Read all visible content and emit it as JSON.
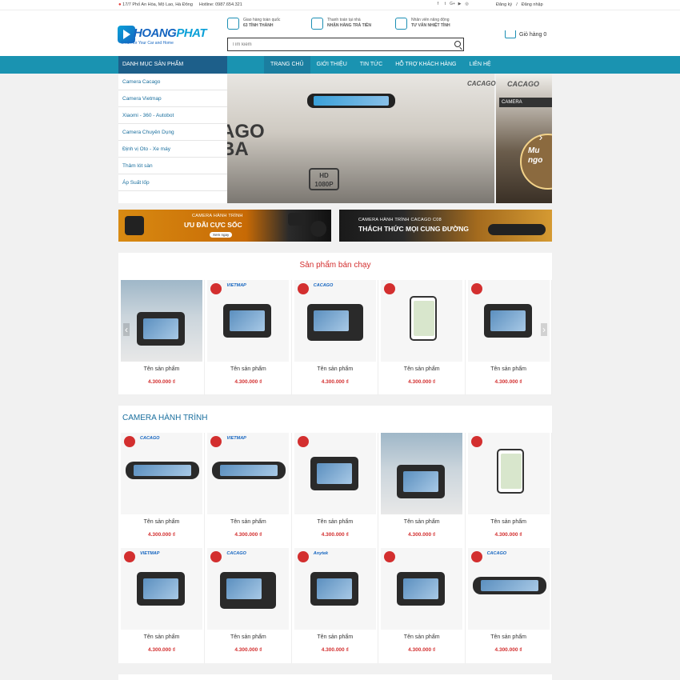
{
  "topbar": {
    "address": "17/7 Phố An Hòa, Mộ Lao, Hà Đông",
    "hotline_label": "Hotline",
    "hotline": "0987.654.321",
    "social": [
      "f",
      "t",
      "G+",
      "▶",
      "◎"
    ],
    "register": "Đăng ký",
    "separator": "/",
    "login": "Đăng nhập"
  },
  "header": {
    "logo_text_1": "HOANG",
    "logo_text_2": "PHAT",
    "logo_tagline": "Smart for Your Car and Home",
    "features": [
      {
        "line1": "Giao hàng toàn quốc",
        "line2": "63 TỈNH THÀNH"
      },
      {
        "line1": "Thanh toán tại nhà",
        "line2": "NHẬN HÀNG TRẢ TIỀN"
      },
      {
        "line1": "Nhân viên năng động",
        "line2": "TƯ VẤN NHIỆT TÌNH"
      }
    ],
    "search_placeholder": "Tìm kiếm",
    "cart_label": "Giỏ hàng 0"
  },
  "nav": {
    "category_title": "DANH MỤC SẢN PHẨM",
    "items": [
      "TRANG CHỦ",
      "GIỚI THIỆU",
      "TIN TỨC",
      "HỖ TRỢ KHÁCH HÀNG",
      "LIÊN HỆ"
    ],
    "active_index": 0
  },
  "sidebar": {
    "items": [
      "Camera Cacago",
      "Camera Vietmap",
      "Xiaomi - 360 - Autobot",
      "Camera Chuyên Dụng",
      "Định vị Oto - Xe máy",
      "Thảm lót sàn",
      "Áp Suất lốp"
    ]
  },
  "slider": {
    "slide1_brand": "CACAGO",
    "slide1_big": "AGO\nBA",
    "slide1_hd": "HD\n1080P",
    "slide2_brand": "CACAGO",
    "slide2_label": "CAMERA",
    "slide2_circle": "Mu\nngo"
  },
  "banners": [
    {
      "line1": "CAMERA HÀNH TRÌNH",
      "line2": "ƯU ĐÃI CỰC SỐC",
      "button": "Xem ngay"
    },
    {
      "line1": "CAMERA HÀNH TRÌNH CACAGO C08",
      "line2": "THÁCH THỨC MỌI CUNG ĐƯỜNG"
    }
  ],
  "best_sellers": {
    "title": "Sản phẩm bán chạy",
    "products": [
      {
        "name": "Tên sản phẩm",
        "price": "4.300.000 ₫",
        "style": "scene",
        "brand": ""
      },
      {
        "name": "Tên sản phẩm",
        "price": "4.300.000 ₫",
        "style": "plain",
        "brand": "VIETMAP"
      },
      {
        "name": "Tên sản phẩm",
        "price": "4.300.000 ₫",
        "style": "tablet",
        "brand": "CACAGO"
      },
      {
        "name": "Tên sản phẩm",
        "price": "4.300.000 ₫",
        "style": "phone",
        "brand": ""
      },
      {
        "name": "Tên sản phẩm",
        "price": "4.300.000 ₫",
        "style": "plain",
        "brand": ""
      }
    ]
  },
  "dashcam": {
    "title": "CAMERA HÀNH TRÌNH",
    "rows": [
      [
        {
          "name": "Tên sản phẩm",
          "price": "4.300.000 ₫",
          "style": "mirrorimg",
          "brand": "CACAGO"
        },
        {
          "name": "Tên sản phẩm",
          "price": "4.300.000 ₫",
          "style": "mirrorimg",
          "brand": "VIETMAP"
        },
        {
          "name": "Tên sản phẩm",
          "price": "4.300.000 ₫",
          "style": "plain",
          "brand": ""
        },
        {
          "name": "Tên sản phẩm",
          "price": "4.300.000 ₫",
          "style": "scene",
          "brand": ""
        },
        {
          "name": "Tên sản phẩm",
          "price": "4.300.000 ₫",
          "style": "phone",
          "brand": ""
        }
      ],
      [
        {
          "name": "Tên sản phẩm",
          "price": "4.300.000 ₫",
          "style": "plain",
          "brand": "VIETMAP"
        },
        {
          "name": "Tên sản phẩm",
          "price": "4.300.000 ₫",
          "style": "tablet",
          "brand": "CACAGO"
        },
        {
          "name": "Tên sản phẩm",
          "price": "4.300.000 ₫",
          "style": "plain",
          "brand": "Anytek"
        },
        {
          "name": "Tên sản phẩm",
          "price": "4.300.000 ₫",
          "style": "plain",
          "brand": ""
        },
        {
          "name": "Tên sản phẩm",
          "price": "4.300.000 ₫",
          "style": "mirrorimg",
          "brand": "CACAGO"
        }
      ]
    ]
  },
  "colors": {
    "nav_bg": "#1a93b1",
    "category_bg": "#1d5f8a",
    "price": "#d32f2f",
    "section_title_red": "#d32f2f",
    "section_title_blue": "#1a6f9e"
  }
}
